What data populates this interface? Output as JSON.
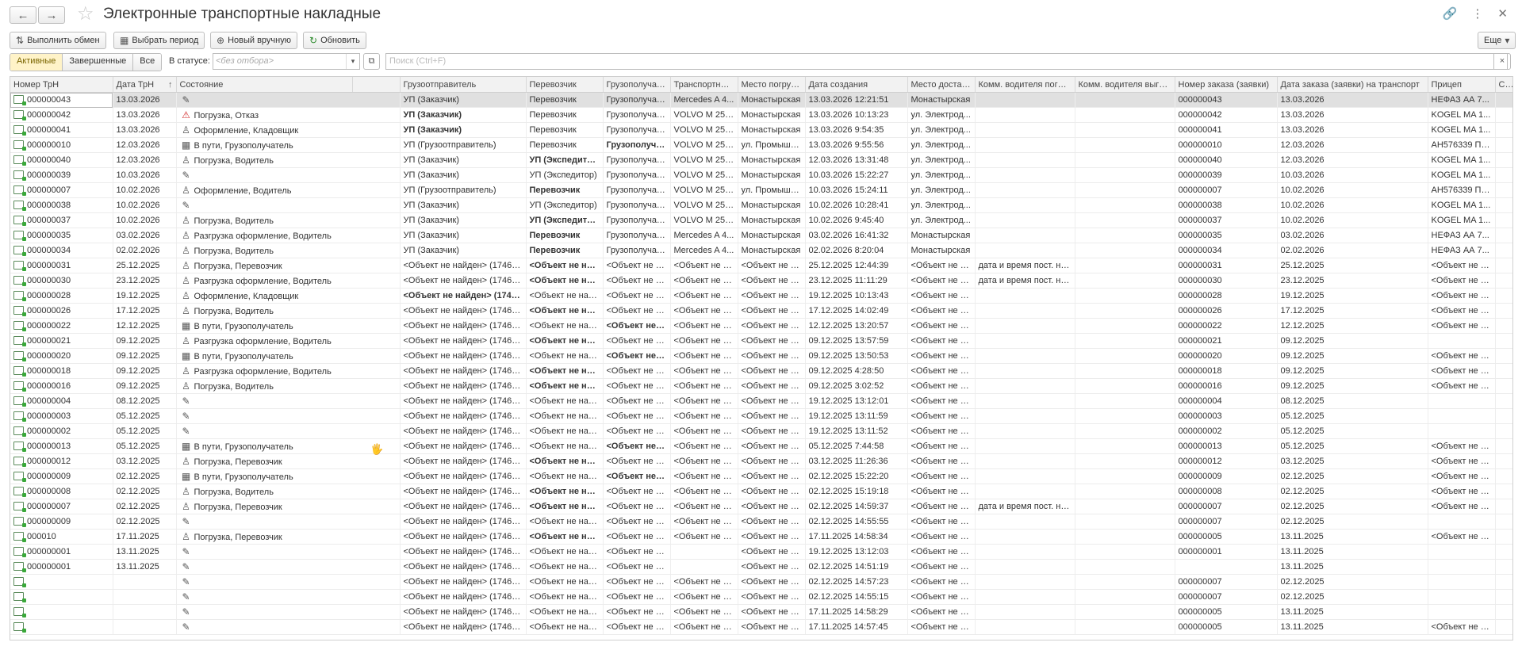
{
  "window": {
    "title": "Электронные транспортные накладные",
    "back_icon": "←",
    "forward_icon": "→",
    "star_icon": "☆",
    "link_icon": "🔗",
    "more_icon": "⋮",
    "close_icon": "✕"
  },
  "toolbar": {
    "exchange": {
      "icon": "⇅",
      "label": "Выполнить обмен"
    },
    "period": {
      "icon": "▦",
      "label": "Выбрать период"
    },
    "new_manual": {
      "icon": "⊕",
      "label": "Новый вручную"
    },
    "refresh": {
      "icon": "↻",
      "label": "Обновить"
    },
    "more": {
      "label": "Еще",
      "arrow": "▾"
    }
  },
  "filters": {
    "tabs": [
      "Активные",
      "Завершенные",
      "Все"
    ],
    "active_tab": "Активные",
    "status_label": "В статусе:",
    "status_placeholder": "<без отбора>",
    "dd_arrow": "▾",
    "copy_icon": "⧉",
    "search_placeholder": "Поиск (Ctrl+F)",
    "search_clear": "×"
  },
  "columns": [
    "Номер ТрН",
    "Дата ТрН",
    "Состояние",
    "",
    "Грузоотправитель",
    "Перевозчик",
    "Грузополучатель",
    "Транспортное средство",
    "Место погрузки",
    "Дата создания",
    "Место доставки",
    "Комм. водителя погрузки",
    "Комм. водителя выгрузки",
    "Номер заказа (заявки)",
    "Дата заказа (заявки) на транспорт",
    "Прицеп",
    "Срок"
  ],
  "sort_arrow": "↑",
  "icons": {
    "pencil": "✎",
    "warn": "⚠",
    "person": "♙",
    "qr": "▦"
  },
  "rows": [
    [
      "000000043",
      "13.03.2026",
      "pencil",
      "",
      "УП (Заказчик)",
      "Перевозчик",
      "Грузополучатель",
      "Mercedes A 4...",
      "Монастырская",
      "13.03.2026 12:21:51",
      "Монастырская",
      "",
      "",
      "000000043",
      "13.03.2026",
      "НЕФАЗ АА 7...",
      ""
    ],
    [
      "000000042",
      "13.03.2026",
      "warn",
      "Погрузка, Отказ",
      "*УП (Заказчик)",
      "Перевозчик",
      "Грузополучатель",
      "VOLVO M 251...",
      "Монастырская",
      "13.03.2026 10:13:23",
      "ул. Электрод...",
      "",
      "",
      "000000042",
      "13.03.2026",
      "KOGEL MA 1...",
      ""
    ],
    [
      "000000041",
      "13.03.2026",
      "person",
      "Оформление, Кладовщик",
      "*УП (Заказчик)",
      "Перевозчик",
      "Грузополучатель",
      "VOLVO M 251...",
      "Монастырская",
      "13.03.2026 9:54:35",
      "ул. Электрод...",
      "",
      "",
      "000000041",
      "13.03.2026",
      "KOGEL MA 1...",
      ""
    ],
    [
      "000000010",
      "12.03.2026",
      "qr",
      "В пути, Грузополучатель",
      "УП (Грузоотправитель)",
      "Перевозчик",
      "*Грузополучатель",
      "VOLVO M 251...",
      "ул. Промышл...",
      "13.03.2026 9:55:56",
      "ул. Электрод...",
      "",
      "",
      "000000010",
      "12.03.2026",
      "АН576339 Пр...",
      ""
    ],
    [
      "000000040",
      "12.03.2026",
      "person",
      "Погрузка, Водитель",
      "УП (Заказчик)",
      "*УП (Экспедитор)",
      "Грузополучатель",
      "VOLVO M 251...",
      "Монастырская",
      "12.03.2026 13:31:48",
      "ул. Электрод...",
      "",
      "",
      "000000040",
      "12.03.2026",
      "KOGEL MA 1...",
      ""
    ],
    [
      "000000039",
      "10.03.2026",
      "pencil",
      "",
      "УП (Заказчик)",
      "УП (Экспедитор)",
      "Грузополучатель",
      "VOLVO M 251...",
      "Монастырская",
      "10.03.2026 15:22:27",
      "ул. Электрод...",
      "",
      "",
      "000000039",
      "10.03.2026",
      "KOGEL MA 1...",
      ""
    ],
    [
      "000000007",
      "10.02.2026",
      "person",
      "Оформление, Водитель",
      "УП (Грузоотправитель)",
      "*Перевозчик",
      "Грузополучатель",
      "VOLVO M 251...",
      "ул. Промышл...",
      "10.03.2026 15:24:11",
      "ул. Электрод...",
      "",
      "",
      "000000007",
      "10.02.2026",
      "АН576339 Пр...",
      ""
    ],
    [
      "000000038",
      "10.02.2026",
      "pencil",
      "",
      "УП (Заказчик)",
      "УП (Экспедитор)",
      "Грузополучатель",
      "VOLVO M 251...",
      "Монастырская",
      "10.02.2026 10:28:41",
      "ул. Электрод...",
      "",
      "",
      "000000038",
      "10.02.2026",
      "KOGEL MA 1...",
      ""
    ],
    [
      "000000037",
      "10.02.2026",
      "person",
      "Погрузка, Водитель",
      "УП (Заказчик)",
      "*УП (Экспедитор)",
      "Грузополучатель",
      "VOLVO M 251...",
      "Монастырская",
      "10.02.2026 9:45:40",
      "ул. Электрод...",
      "",
      "",
      "000000037",
      "10.02.2026",
      "KOGEL MA 1...",
      ""
    ],
    [
      "000000035",
      "03.02.2026",
      "person",
      "Разгрузка оформление, Водитель",
      "УП (Заказчик)",
      "*Перевозчик",
      "Грузополучатель",
      "Mercedes A 4...",
      "Монастырская",
      "03.02.2026 16:41:32",
      "Монастырская",
      "",
      "",
      "000000035",
      "03.02.2026",
      "НЕФАЗ АА 7...",
      ""
    ],
    [
      "000000034",
      "02.02.2026",
      "person",
      "Погрузка, Водитель",
      "УП (Заказчик)",
      "*Перевозчик",
      "Грузополучатель",
      "Mercedes A 4...",
      "Монастырская",
      "02.02.2026 8:20:04",
      "Монастырская",
      "",
      "",
      "000000034",
      "02.02.2026",
      "НЕФАЗ АА 7...",
      ""
    ],
    [
      "000000031",
      "25.12.2025",
      "person",
      "Погрузка, Перевозчик",
      "<Объект не найден> (17461:...",
      "*<Объект не найден>",
      "<Объект не найден>",
      "<Объект не найден>",
      "<Объект не найден>",
      "25.12.2025 12:44:39",
      "<Объект не найден>",
      "дата и время пост. на погрузку",
      "",
      "000000031",
      "25.12.2025",
      "<Объект не найден>",
      ""
    ],
    [
      "000000030",
      "23.12.2025",
      "person",
      "Разгрузка оформление, Водитель",
      "<Объект не найден> (17461:...",
      "*<Объект не найден>",
      "<Объект не найден>",
      "<Объект не найден>",
      "<Объект не найден>",
      "23.12.2025 11:11:29",
      "<Объект не найден>",
      "дата и время пост. на погрузку",
      "",
      "000000030",
      "23.12.2025",
      "<Объект не найден>",
      ""
    ],
    [
      "000000028",
      "19.12.2025",
      "person",
      "Оформление, Кладовщик",
      "*<Объект не найден> (17461:...",
      "<Объект не найден>",
      "<Объект не найден>",
      "<Объект не найден>",
      "<Объект не найден>",
      "19.12.2025 10:13:43",
      "<Объект не найден>",
      "",
      "",
      "000000028",
      "19.12.2025",
      "<Объект не найден>",
      ""
    ],
    [
      "000000026",
      "17.12.2025",
      "person",
      "Погрузка, Водитель",
      "<Объект не найден> (17461:...",
      "*<Объект не найден>",
      "<Объект не найден>",
      "<Объект не найден>",
      "<Объект не найден>",
      "17.12.2025 14:02:49",
      "<Объект не найден>",
      "",
      "",
      "000000026",
      "17.12.2025",
      "<Объект не найден>",
      ""
    ],
    [
      "000000022",
      "12.12.2025",
      "qr",
      "В пути, Грузополучатель",
      "<Объект не найден> (17461:...",
      "<Объект не найден>",
      "*<Объект не найден>",
      "<Объект не найден>",
      "<Объект не найден>",
      "12.12.2025 13:20:57",
      "<Объект не найден>",
      "",
      "",
      "000000022",
      "12.12.2025",
      "<Объект не найден>",
      ""
    ],
    [
      "000000021",
      "09.12.2025",
      "person",
      "Разгрузка оформление, Водитель",
      "<Объект не найден> (17461:...",
      "*<Объект не найден>",
      "<Объект не найден>",
      "<Объект не найден>",
      "<Объект не найден>",
      "09.12.2025 13:57:59",
      "<Объект не найден>",
      "",
      "",
      "000000021",
      "09.12.2025",
      "",
      ""
    ],
    [
      "000000020",
      "09.12.2025",
      "qr",
      "В пути, Грузополучатель",
      "<Объект не найден> (17461:...",
      "<Объект не найден>",
      "*<Объект не найден>",
      "<Объект не найден>",
      "<Объект не найден>",
      "09.12.2025 13:50:53",
      "<Объект не найден>",
      "",
      "",
      "000000020",
      "09.12.2025",
      "<Объект не найден>",
      ""
    ],
    [
      "000000018",
      "09.12.2025",
      "person",
      "Разгрузка оформление, Водитель",
      "<Объект не найден> (17461:...",
      "*<Объект не найден>",
      "<Объект не найден>",
      "<Объект не найден>",
      "<Объект не найден>",
      "09.12.2025 4:28:50",
      "<Объект не найден>",
      "",
      "",
      "000000018",
      "09.12.2025",
      "<Объект не найден>",
      ""
    ],
    [
      "000000016",
      "09.12.2025",
      "person",
      "Погрузка, Водитель",
      "<Объект не найден> (17461:...",
      "*<Объект не найден>",
      "<Объект не найден>",
      "<Объект не найден>",
      "<Объект не найден>",
      "09.12.2025 3:02:52",
      "<Объект не найден>",
      "",
      "",
      "000000016",
      "09.12.2025",
      "<Объект не найден>",
      ""
    ],
    [
      "000000004",
      "08.12.2025",
      "pencil",
      "",
      "<Объект не найден> (17461:...",
      "<Объект не найден>",
      "<Объект не найден>",
      "<Объект не найден>",
      "<Объект не найден>",
      "19.12.2025 13:12:01",
      "<Объект не найден>",
      "",
      "",
      "000000004",
      "08.12.2025",
      "",
      ""
    ],
    [
      "000000003",
      "05.12.2025",
      "pencil",
      "",
      "<Объект не найден> (17461:...",
      "<Объект не найден>",
      "<Объект не найден>",
      "<Объект не найден>",
      "<Объект не найден>",
      "19.12.2025 13:11:59",
      "<Объект не найден>",
      "",
      "",
      "000000003",
      "05.12.2025",
      "",
      ""
    ],
    [
      "000000002",
      "05.12.2025",
      "pencil",
      "",
      "<Объект не найден> (17461:...",
      "<Объект не найден>",
      "<Объект не найден>",
      "<Объект не найден>",
      "<Объект не найден>",
      "19.12.2025 13:11:52",
      "<Объект не найден>",
      "",
      "",
      "000000002",
      "05.12.2025",
      "",
      ""
    ],
    [
      "000000013",
      "05.12.2025",
      "qr",
      "В пути, Грузополучатель",
      "<Объект не найден> (17461:...",
      "<Объект не найден>",
      "*<Объект не найден>",
      "<Объект не найден>",
      "<Объект не найден>",
      "05.12.2025 7:44:58",
      "<Объект не найден>",
      "",
      "",
      "000000013",
      "05.12.2025",
      "<Объект не найден>",
      ""
    ],
    [
      "000000012",
      "03.12.2025",
      "person",
      "Погрузка, Перевозчик",
      "<Объект не найден> (17461:...",
      "*<Объект не найден>",
      "<Объект не найден>",
      "<Объект не найден>",
      "<Объект не найден>",
      "03.12.2025 11:26:36",
      "<Объект не найден>",
      "",
      "",
      "000000012",
      "03.12.2025",
      "<Объект не найден>",
      ""
    ],
    [
      "000000009",
      "02.12.2025",
      "qr",
      "В пути, Грузополучатель",
      "<Объект не найден> (17461:...",
      "<Объект не найден>",
      "*<Объект не найден>",
      "<Объект не найден>",
      "<Объект не найден>",
      "02.12.2025 15:22:20",
      "<Объект не найден>",
      "",
      "",
      "000000009",
      "02.12.2025",
      "<Объект не найден>",
      ""
    ],
    [
      "000000008",
      "02.12.2025",
      "person",
      "Погрузка, Водитель",
      "<Объект не найден> (17461:...",
      "*<Объект не найден>",
      "<Объект не найден>",
      "<Объект не найден>",
      "<Объект не найден>",
      "02.12.2025 15:19:18",
      "<Объект не найден>",
      "",
      "",
      "000000008",
      "02.12.2025",
      "<Объект не найден>",
      ""
    ],
    [
      "000000007",
      "02.12.2025",
      "person",
      "Погрузка, Перевозчик",
      "<Объект не найден> (17461:...",
      "*<Объект не найден>",
      "<Объект не найден>",
      "<Объект не найден>",
      "<Объект не найден>",
      "02.12.2025 14:59:37",
      "<Объект не найден>",
      "дата и время пост. на погрузку",
      "",
      "000000007",
      "02.12.2025",
      "<Объект не найден>",
      ""
    ],
    [
      "000000009",
      "02.12.2025",
      "pencil",
      "",
      "<Объект не найден> (17461:...",
      "<Объект не найден>",
      "<Объект не найден>",
      "<Объект не найден>",
      "<Объект не найден>",
      "02.12.2025 14:55:55",
      "<Объект не найден>",
      "",
      "",
      "000000007",
      "02.12.2025",
      "",
      ""
    ],
    [
      "000010",
      "17.11.2025",
      "person",
      "Погрузка, Перевозчик",
      "<Объект не найден> (17461:...",
      "*<Объект не найден>",
      "<Объект не найден>",
      "<Объект не найден>",
      "<Объект не найден>",
      "17.11.2025 14:58:34",
      "<Объект не найден>",
      "",
      "",
      "000000005",
      "13.11.2025",
      "<Объект не найден>",
      ""
    ],
    [
      "000000001",
      "13.11.2025",
      "pencil",
      "",
      "<Объект не найден> (17461:...",
      "<Объект не найден>",
      "<Объект не найден>",
      "",
      "<Объект не найден>",
      "19.12.2025 13:12:03",
      "<Объект не найден>",
      "",
      "",
      "000000001",
      "13.11.2025",
      "",
      ""
    ],
    [
      "000000001",
      "13.11.2025",
      "pencil",
      "",
      "<Объект не найден> (17461:...",
      "<Объект не найден>",
      "<Объект не найден>",
      "",
      "<Объект не найден>",
      "02.12.2025 14:51:19",
      "<Объект не найден>",
      "",
      "",
      "",
      "13.11.2025",
      "",
      ""
    ],
    [
      "",
      "",
      "pencil",
      "",
      "<Объект не найден> (17461:...",
      "<Объект не найден>",
      "<Объект не найден>",
      "<Объект не найден>",
      "<Объект не найден>",
      "02.12.2025 14:57:23",
      "<Объект не найден>",
      "",
      "",
      "000000007",
      "02.12.2025",
      "",
      ""
    ],
    [
      "",
      "",
      "pencil",
      "",
      "<Объект не найден> (17461:...",
      "<Объект не найден>",
      "<Объект не найден>",
      "<Объект не найден>",
      "<Объект не найден>",
      "02.12.2025 14:55:15",
      "<Объект не найден>",
      "",
      "",
      "000000007",
      "02.12.2025",
      "",
      ""
    ],
    [
      "",
      "",
      "pencil",
      "",
      "<Объект не найден> (17461:...",
      "<Объект не найден>",
      "<Объект не найден>",
      "<Объект не найден>",
      "<Объект не найден>",
      "17.11.2025 14:58:29",
      "<Объект не найден>",
      "",
      "",
      "000000005",
      "13.11.2025",
      "",
      ""
    ],
    [
      "",
      "",
      "pencil",
      "",
      "<Объект не найден> (17461:...",
      "<Объект не найден>",
      "<Объект не найден>",
      "<Объект не найден>",
      "<Объект не найден>",
      "17.11.2025 14:57:45",
      "<Объект не найден>",
      "",
      "",
      "000000005",
      "13.11.2025",
      "<Объект не найден>",
      ""
    ]
  ],
  "cursor_icon": "🖐"
}
